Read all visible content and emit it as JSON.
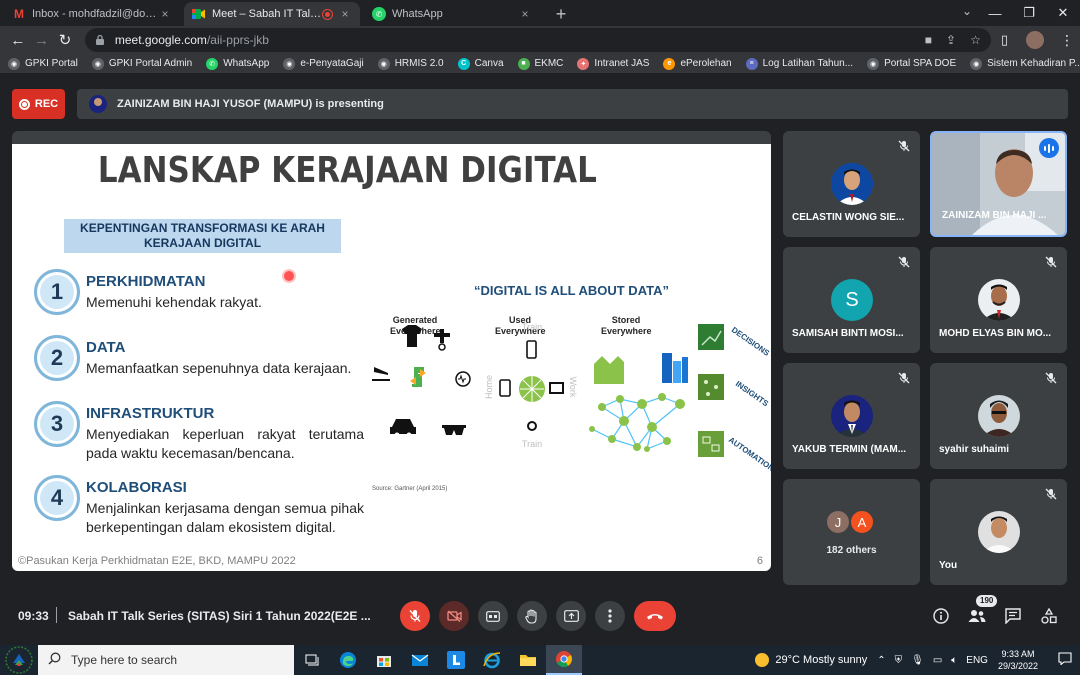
{
  "browser": {
    "tabs": [
      {
        "title": "Inbox - mohdfadzil@doe.gov.my",
        "icon": "gmail-icon",
        "active": false
      },
      {
        "title": "Meet – Sabah IT Talk Series (",
        "icon": "meet-icon",
        "active": true
      },
      {
        "title": "WhatsApp",
        "icon": "whatsapp-icon",
        "active": false
      }
    ],
    "new_tab_label": "+",
    "url_host": "meet.google.com",
    "url_path": "/aii-pprs-jkb",
    "bookmarks": [
      {
        "label": "GPKI Portal",
        "color": "#5f6368"
      },
      {
        "label": "GPKI Portal Admin",
        "color": "#5f6368"
      },
      {
        "label": "WhatsApp",
        "color": "#25d366"
      },
      {
        "label": "e-PenyataGaji",
        "color": "#5f6368"
      },
      {
        "label": "HRMIS 2.0",
        "color": "#5f6368"
      },
      {
        "label": "Canva",
        "color": "#00c4cc"
      },
      {
        "label": "EKMC",
        "color": "#4caf50"
      },
      {
        "label": "Intranet JAS",
        "color": "#e57373"
      },
      {
        "label": "ePerolehan",
        "color": "#ff9800"
      },
      {
        "label": "Log Latihan Tahun...",
        "color": "#5c6bc0"
      },
      {
        "label": "Portal SPA DOE",
        "color": "#5f6368"
      },
      {
        "label": "Sistem Kehadiran P...",
        "color": "#5f6368"
      }
    ],
    "bookmarks_more": "»"
  },
  "meet": {
    "rec_label": "REC",
    "presenting_text": "ZAINIZAM BIN HAJI YUSOF (MAMPU) is presenting",
    "time": "09:33",
    "meeting_name": "Sabah IT Talk Series (SITAS) Siri 1 Tahun 2022(E2E ...",
    "people_count": "190",
    "participants": [
      {
        "name": "CELASTIN WONG SIE...",
        "type": "photo",
        "muted": true
      },
      {
        "name": "ZAINIZAM BIN HAJI ...",
        "type": "video",
        "muted": false,
        "speaking": true
      },
      {
        "name": "SAMISAH BINTI MOSI...",
        "type": "letter",
        "letter": "S",
        "muted": true
      },
      {
        "name": "MOHD ELYAS BIN MO...",
        "type": "photo",
        "muted": true
      },
      {
        "name": "YAKUB TERMIN (MAM...",
        "type": "photo",
        "muted": true
      },
      {
        "name": "syahir suhaimi",
        "type": "photo",
        "muted": true
      },
      {
        "name": "182 others",
        "type": "others",
        "letters": [
          "J",
          "A"
        ],
        "muted": false
      },
      {
        "name": "You",
        "type": "photo",
        "muted": true
      }
    ]
  },
  "slide": {
    "title": "LANSKAP KERAJAAN DIGITAL",
    "key_line1": "KEPENTINGAN TRANSFORMASI KE ARAH",
    "key_line2": "KERAJAAN DIGITAL",
    "points": [
      {
        "num": "1",
        "head": "PERKHIDMATAN",
        "body": "Memenuhi kehendak rakyat."
      },
      {
        "num": "2",
        "head": "DATA",
        "body": "Memanfaatkan sepenuhnya data kerajaan."
      },
      {
        "num": "3",
        "head": "INFRASTRUKTUR",
        "body": "Menyediakan keperluan rakyat terutama pada waktu kecemasan/bencana."
      },
      {
        "num": "4",
        "head": "KOLABORASI",
        "body": "Menjalinkan kerjasama dengan semua pihak berkepentingan dalam ekosistem digital."
      }
    ],
    "data_title": "“DIGITAL IS ALL ABOUT DATA”",
    "columns": [
      {
        "line1": "Generated",
        "line2": "Everywhere"
      },
      {
        "line1": "Used",
        "line2": "Everywhere"
      },
      {
        "line1": "Stored",
        "line2": "Everywhere"
      }
    ],
    "used_labels": {
      "top": "Train",
      "left": "Home",
      "right": "Work",
      "bottom": "Train"
    },
    "side_labels": [
      "DECISIONS",
      "INSIGHTS",
      "AUTOMATION"
    ],
    "source": "Source: Gartner (April 2015)",
    "footer": "©Pasukan Kerja Perkhidmatan E2E, BKD, MAMPU 2022",
    "page": "6"
  },
  "taskbar": {
    "search_placeholder": "Type here to search",
    "weather": "29°C  Mostly sunny",
    "lang": "ENG",
    "time": "9:33 AM",
    "date": "29/3/2022"
  }
}
